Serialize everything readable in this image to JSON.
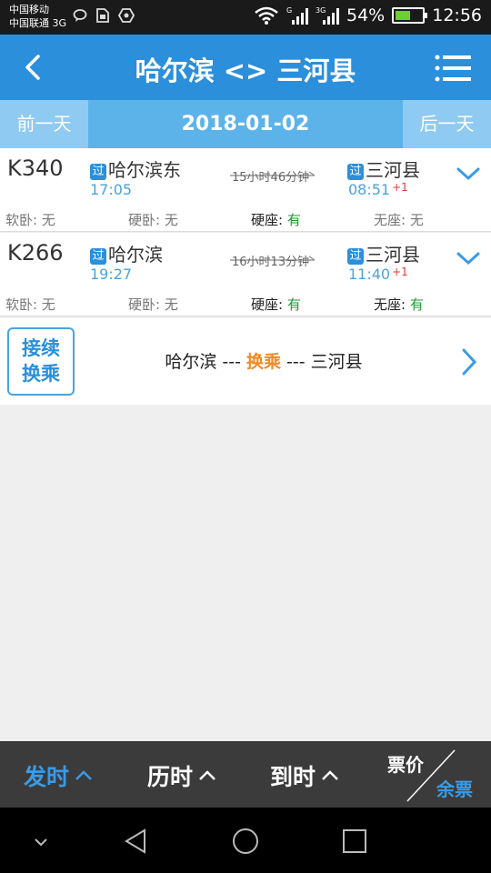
{
  "status_bar": {
    "carrier1": "中国移动",
    "carrier2": "中国联通 3G",
    "battery": "54%",
    "time": "12:56"
  },
  "header": {
    "title": "哈尔滨 <> 三河县",
    "back_icon": "chevron-left-icon",
    "menu_icon": "hamburger-menu-icon"
  },
  "date_nav": {
    "prev_label": "前一天",
    "date": "2018-01-02",
    "next_label": "后一天"
  },
  "trains": [
    {
      "train_no": "K340",
      "pass_badge": "过",
      "from_station": "哈尔滨东",
      "depart_time": "17:05",
      "duration": "15小时46分钟",
      "to_station": "三河县",
      "arrive_time": "08:51",
      "day_offset": "+1",
      "soft_sleeper_label": "软卧: ",
      "soft_sleeper": "无",
      "hard_sleeper_label": "硬卧: ",
      "hard_sleeper": "无",
      "hard_seat_label": "硬座: ",
      "hard_seat": "有",
      "no_seat_label": "无座: ",
      "no_seat": "无"
    },
    {
      "train_no": "K266",
      "pass_badge": "过",
      "from_station": "哈尔滨",
      "depart_time": "19:27",
      "duration": "16小时13分钟",
      "to_station": "三河县",
      "arrive_time": "11:40",
      "day_offset": "+1",
      "soft_sleeper_label": "软卧: ",
      "soft_sleeper": "无",
      "hard_sleeper_label": "硬卧: ",
      "hard_sleeper": "无",
      "hard_seat_label": "硬座: ",
      "hard_seat": "有",
      "no_seat_label": "无座: ",
      "no_seat": "有"
    }
  ],
  "transfer": {
    "badge_line1": "接续",
    "badge_line2": "换乘",
    "from": "哈尔滨",
    "sep1": " --- ",
    "middle": "换乘",
    "sep2": " --- ",
    "to": "三河县"
  },
  "sort_bar": {
    "depart": "发时",
    "duration": "历时",
    "arrive": "到时",
    "price": "票价",
    "tickets": "余票"
  },
  "colors": {
    "primary": "#2b8fdb",
    "available": "#1a9a35",
    "transfer_highlight": "#f08a24",
    "day_offset": "#e0393c"
  }
}
